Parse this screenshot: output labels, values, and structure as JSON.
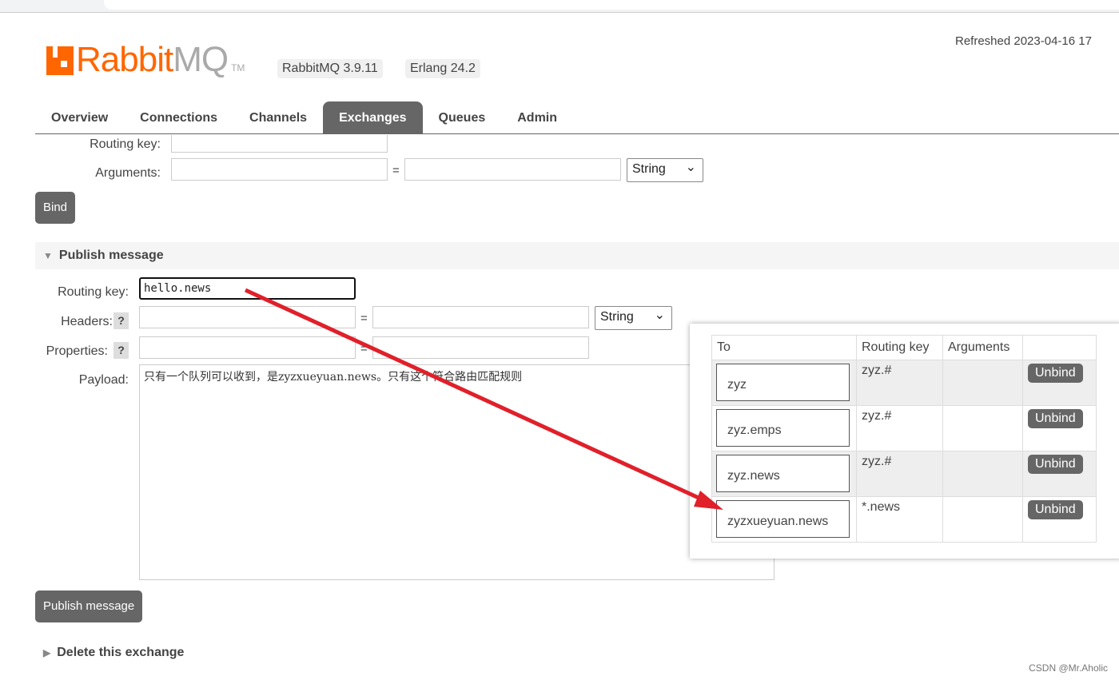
{
  "header": {
    "logo_text_orange": "Rabbit",
    "logo_text_gray": "MQ",
    "logo_tm": "TM",
    "version": "RabbitMQ 3.9.11",
    "erlang": "Erlang 24.2",
    "refreshed": "Refreshed 2023-04-16 17"
  },
  "tabs": [
    {
      "label": "Overview"
    },
    {
      "label": "Connections"
    },
    {
      "label": "Channels"
    },
    {
      "label": "Exchanges",
      "active": true
    },
    {
      "label": "Queues"
    },
    {
      "label": "Admin"
    }
  ],
  "bind": {
    "routing_key_label": "Routing key:",
    "arguments_label": "Arguments:",
    "eq": "=",
    "type": "String",
    "button": "Bind"
  },
  "publish": {
    "title": "Publish message",
    "routing_key_label": "Routing key:",
    "routing_key_value": "hello.news",
    "headers_label": "Headers:",
    "properties_label": "Properties:",
    "help": "?",
    "eq": "=",
    "type": "String",
    "payload_label": "Payload:",
    "payload_value": "只有一个队列可以收到，是zyzxueyuan.news。只有这个符合路由匹配规则",
    "button": "Publish message"
  },
  "bindings": {
    "headers": [
      "To",
      "Routing key",
      "Arguments",
      ""
    ],
    "rows": [
      {
        "to": "zyz",
        "key": "zyz.#",
        "args": "",
        "action": "Unbind"
      },
      {
        "to": "zyz.emps",
        "key": "zyz.#",
        "args": "",
        "action": "Unbind"
      },
      {
        "to": "zyz.news",
        "key": "zyz.#",
        "args": "",
        "action": "Unbind"
      },
      {
        "to": "zyzxueyuan.news",
        "key": "*.news",
        "args": "",
        "action": "Unbind"
      }
    ]
  },
  "delete": {
    "title": "Delete this exchange"
  },
  "watermark": "CSDN @Mr.Aholic",
  "colors": {
    "brand": "#ff6600",
    "arrow": "#e0202a",
    "tab_active": "#666666"
  }
}
